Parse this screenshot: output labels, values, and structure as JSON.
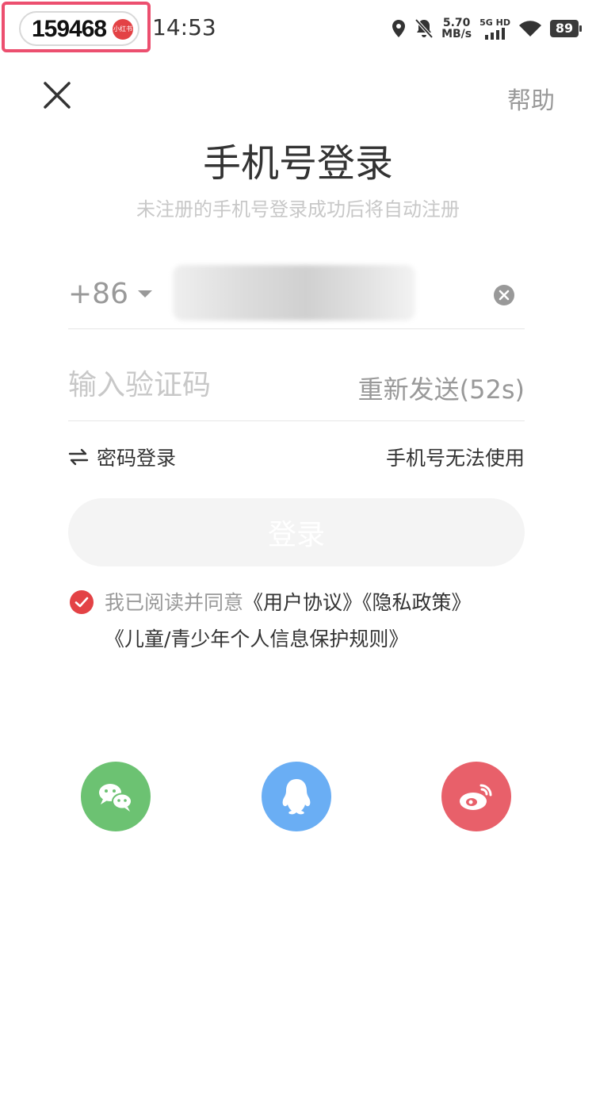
{
  "status_bar": {
    "badge_number": "159468",
    "badge_logo": "小红书",
    "time": "14:53",
    "speed_value": "5.70",
    "speed_unit": "MB/s",
    "network": "5G HD",
    "battery": "89",
    "icons": [
      "location-icon",
      "bell-muted-icon",
      "signal-icon",
      "wifi-icon",
      "battery-icon"
    ]
  },
  "header": {
    "help": "帮助",
    "title": "手机号登录",
    "subtitle": "未注册的手机号登录成功后将自动注册"
  },
  "form": {
    "country_code": "+86",
    "code_placeholder": "输入验证码",
    "resend": "重新发送(52s)",
    "password_login": "密码登录",
    "phone_unusable": "手机号无法使用",
    "login_button": "登录"
  },
  "agreement": {
    "prefix": "我已阅读并同意",
    "user_agreement": "《用户协议》",
    "privacy_policy": "《隐私政策》",
    "child_policy": "《儿童/青少年个人信息保护规则》",
    "checked": true
  },
  "social": [
    "wechat-login",
    "qq-login",
    "weibo-login"
  ],
  "colors": {
    "accent_red": "#e34245",
    "wechat": "#6cc272",
    "qq": "#6aaef4",
    "weibo": "#e8606a",
    "highlight_frame": "#ec4f6f"
  }
}
